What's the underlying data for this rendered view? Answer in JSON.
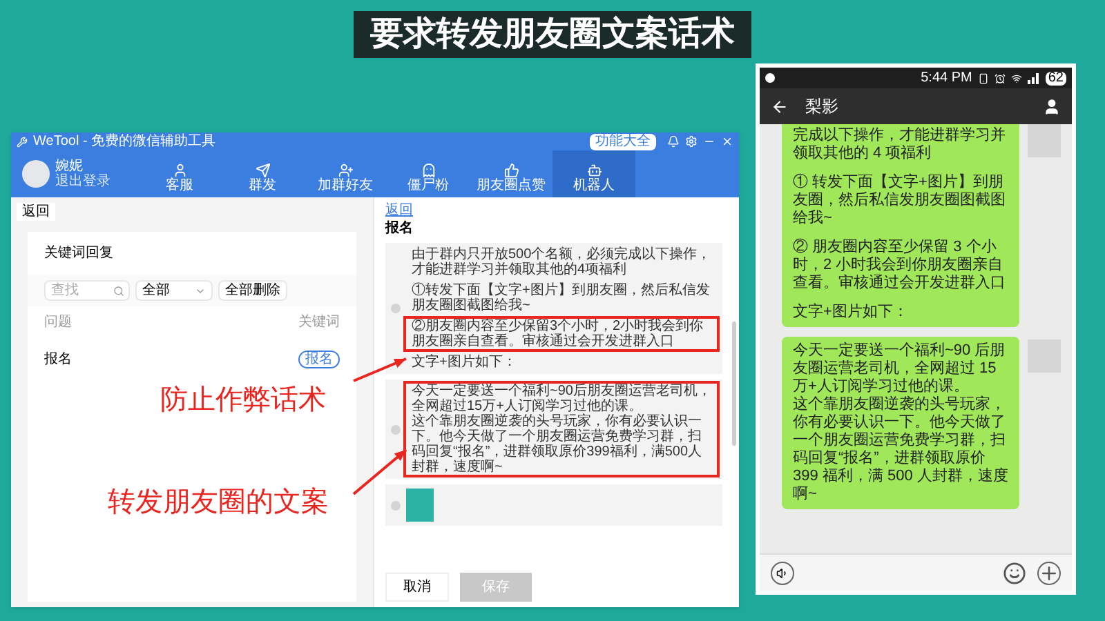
{
  "slide_title": "要求转发朋友圈文案话术",
  "annotations": [
    {
      "text": "防止作弊话术"
    },
    {
      "text": "转发朋友圈的文案"
    }
  ],
  "desktop_app": {
    "title": "WeTool - 免费的微信辅助工具",
    "user": {
      "name": "婉妮",
      "action": "退出登录"
    },
    "feature_button": "功能大全",
    "nav": [
      {
        "label": "客服",
        "selected": false
      },
      {
        "label": "群发",
        "selected": false
      },
      {
        "label": "加群好友",
        "selected": false
      },
      {
        "label": "僵尸粉",
        "selected": false
      },
      {
        "label": "朋友圈点赞",
        "selected": false
      },
      {
        "label": "机器人",
        "selected": true
      }
    ],
    "back": "返回",
    "keyword_panel": {
      "title": "关键词回复",
      "search": {
        "placeholder": "查找"
      },
      "filter": "全部",
      "delete_all": "全部删除",
      "columns": [
        "问题",
        "关键词"
      ],
      "rows": [
        {
          "question": "报名",
          "keyword": "报名"
        }
      ]
    },
    "reply_panel": {
      "back": "返回",
      "title": "报名",
      "messages": [
        {
          "kind": "text",
          "blocks": [
            {
              "lines": [
                "由于群内只开放500个名额，必须完成以下操作，才能进群学习并领取其他的4项福利"
              ],
              "highlighted": false
            },
            {
              "lines": [
                "①转发下面【文字+图片】到朋友圈，然后私信发朋友圈图截图给我~"
              ],
              "highlighted": false
            },
            {
              "lines": [
                "②朋友圈内容至少保留3个小时，2小时我会到你朋友圈亲自查看。审核通过会开发进群入口"
              ],
              "highlighted": true
            },
            {
              "lines": [
                "文字+图片如下："
              ],
              "highlighted": false
            }
          ]
        },
        {
          "kind": "text",
          "blocks": [
            {
              "lines": [
                "今天一定要送一个福利~90后朋友圈运营老司机，全网超过15万+人订阅学习过他的课。",
                "这个靠朋友圈逆袭的头号玩家，你有必要认识一下。他今天做了一个朋友圈运营免费学习群，扫码回复“报名”，进群领取原价399福利，满500人封群，速度啊~"
              ],
              "highlighted": true
            }
          ]
        },
        {
          "kind": "image"
        }
      ],
      "cancel": "取消",
      "save": {
        "label": "保存",
        "disabled": true
      }
    }
  },
  "phone": {
    "time": "5:44 PM",
    "battery": "62",
    "contact": "梨影",
    "messages": [
      {
        "paragraphs": [
          "完成以下操作，才能进群学习并领取其他的 4 项福利",
          "① 转发下面【文字+图片】到朋友圈，然后私信发朋友圈图截图给我~",
          "② 朋友圈内容至少保留 3 个小时，2 小时我会到你朋友圈亲自查看。审核通过会开发进群入口",
          "文字+图片如下："
        ],
        "spaced": true,
        "cut_top": true
      },
      {
        "paragraphs": [
          "今天一定要送一个福利~90 后朋友圈运营老司机，全网超过 15 万+人订阅学习过他的课。",
          "这个靠朋友圈逆袭的头号玩家，你有必要认识一下。他今天做了一个朋友圈运营免费学习群，扫码回复“报名”，进群领取原价 399 福利，满 500 人封群，速度啊~"
        ],
        "spaced": false,
        "cut_top": false
      }
    ]
  }
}
